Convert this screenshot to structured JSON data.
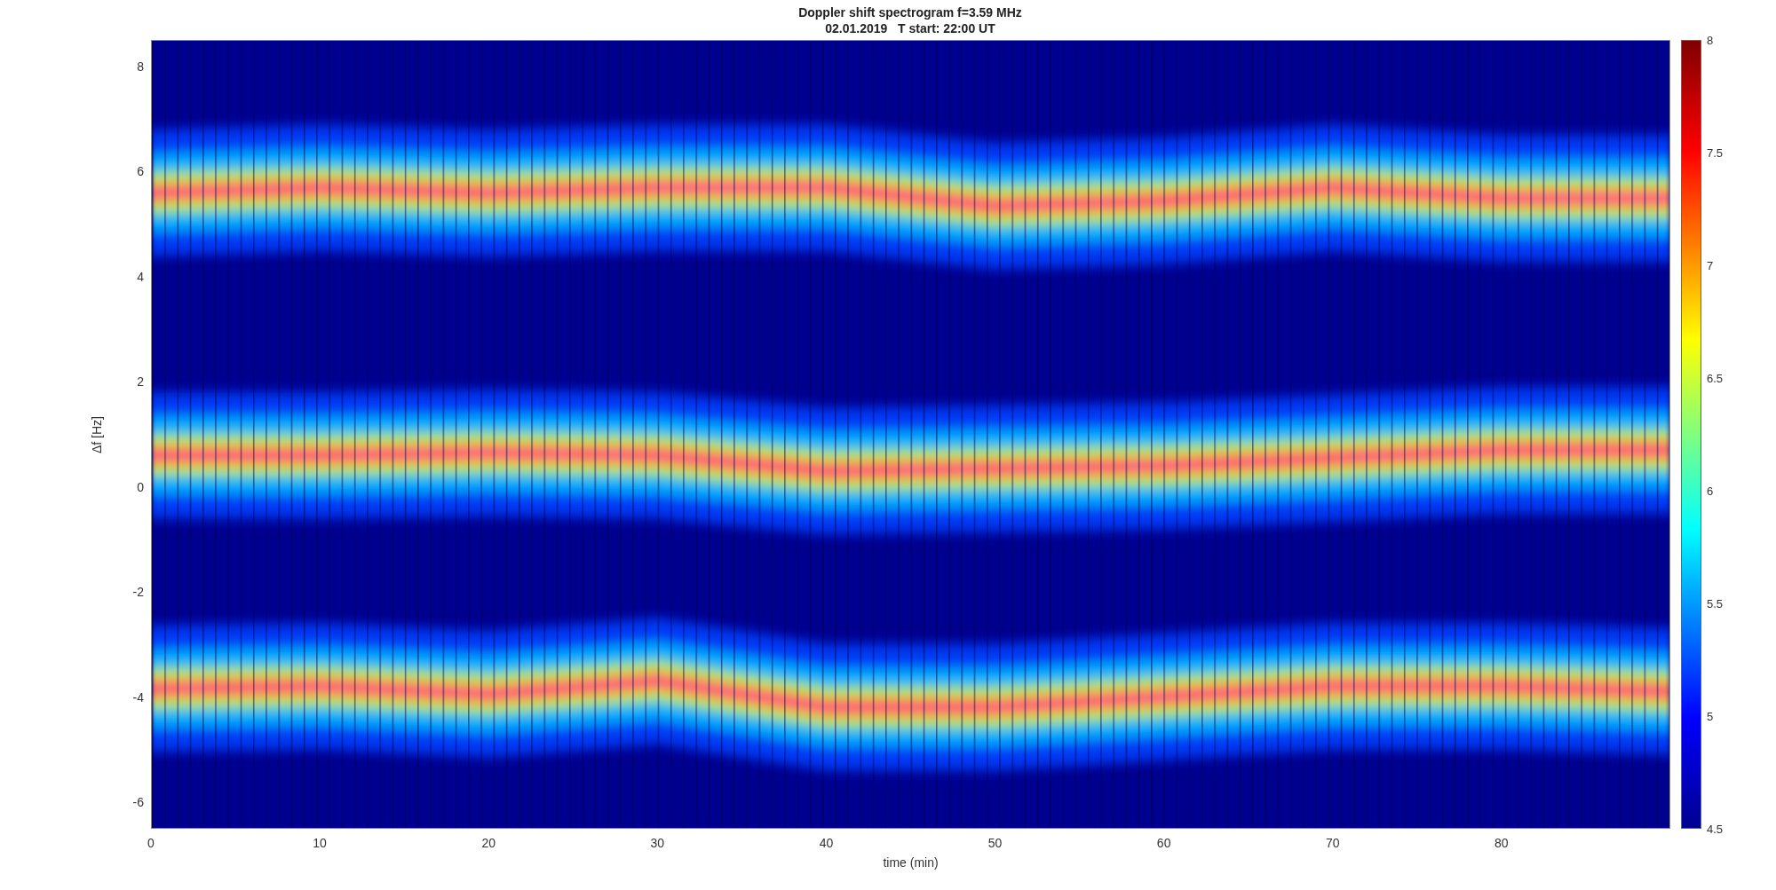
{
  "figure": {
    "title": "Doppler shift spectrogram f=3.59 MHz",
    "subtitle": "02.01.2019   T start: 22:00 UT",
    "xlabel": "time (min)",
    "ylabel": "Δf [Hz]",
    "xticks": [
      "0",
      "10",
      "20",
      "30",
      "40",
      "50",
      "60",
      "70",
      "80"
    ],
    "yticks": [
      "8",
      "6",
      "4",
      "2",
      "0",
      "-2",
      "-4",
      "-6"
    ],
    "colorbar_ticks": [
      "8",
      "7.5",
      "7",
      "6.5",
      "6",
      "5.5",
      "5",
      "4.5"
    ]
  }
}
